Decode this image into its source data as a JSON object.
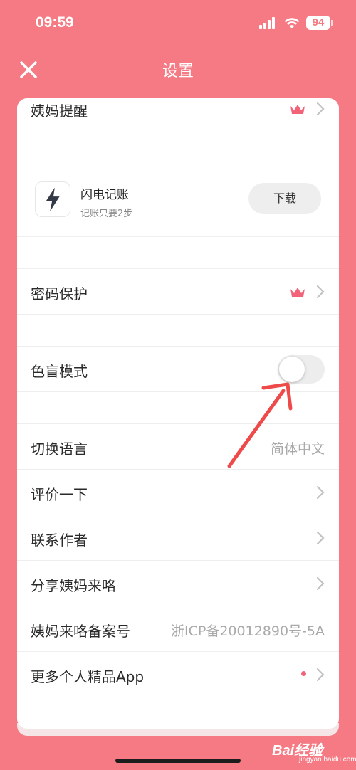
{
  "status_bar": {
    "time": "09:59",
    "battery": "94"
  },
  "nav": {
    "title": "设置",
    "close_icon": "close-icon"
  },
  "colors": {
    "background": "#f57a84",
    "accent": "#f2637a",
    "card": "#ffffff"
  },
  "settings": {
    "period_reminder": {
      "label": "姨妈提醒",
      "icon": "crown-icon"
    },
    "promo_app": {
      "name": "闪电记账",
      "subtitle": "记账只要2步",
      "button": "下载",
      "icon": "lightning-icon"
    },
    "password_protection": {
      "label": "密码保护",
      "icon": "crown-icon"
    },
    "color_blind_mode": {
      "label": "色盲模式",
      "enabled": false
    },
    "language": {
      "label": "切换语言",
      "value": "简体中文"
    },
    "rate": {
      "label": "评价一下"
    },
    "contact": {
      "label": "联系作者"
    },
    "share": {
      "label": "分享姨妈来咯"
    },
    "icp": {
      "label": "姨妈来咯备案号",
      "value": "浙ICP备20012890号-5A"
    },
    "more_apps": {
      "label": "更多个人精品App"
    }
  },
  "watermark": {
    "text": "Bai经验",
    "sub": "jingyan.baidu.com"
  }
}
